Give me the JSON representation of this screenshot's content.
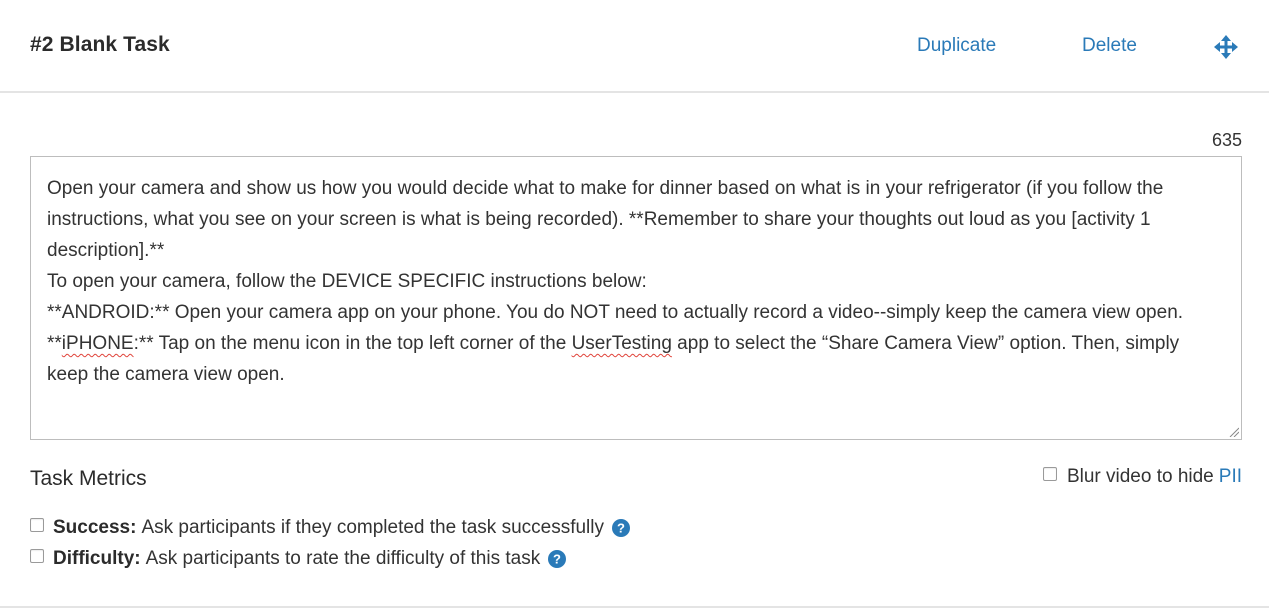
{
  "task": {
    "title": "#2 Blank Task",
    "duplicate_label": "Duplicate",
    "delete_label": "Delete",
    "move_icon": "move-arrows-icon"
  },
  "editor": {
    "char_count": "635",
    "paragraphs": [
      "Open your camera and show us how you would decide what to make for dinner based on what is in your refrigerator (if you follow the instructions, what you see on your screen is what is being recorded). **Remember to share your thoughts out loud as you [activity 1 description].**",
      "To open your camera, follow the DEVICE SPECIFIC instructions below:",
      "**ANDROID:** Open your camera app on your phone. You do NOT need to actually record a video--simply keep the camera view open."
    ],
    "iphone": {
      "prefix": "**",
      "word": "iPHONE",
      "mid": ":** Tap on the menu icon in the top left corner of the ",
      "brand": "UserTesting",
      "suffix": " app to select the “Share Camera View” option. Then, simply keep the camera view open."
    }
  },
  "metrics": {
    "title": "Task Metrics",
    "blur_label": "Blur video to hide",
    "blur_link": "PII",
    "success_label": "Success:",
    "success_text": "Ask participants if they completed the task successfully",
    "difficulty_label": "Difficulty:",
    "difficulty_text": "Ask participants to rate the difficulty of this task"
  },
  "colors": {
    "link": "#2a7ab8",
    "text": "#333333",
    "spellcheck": "#e0433a"
  }
}
